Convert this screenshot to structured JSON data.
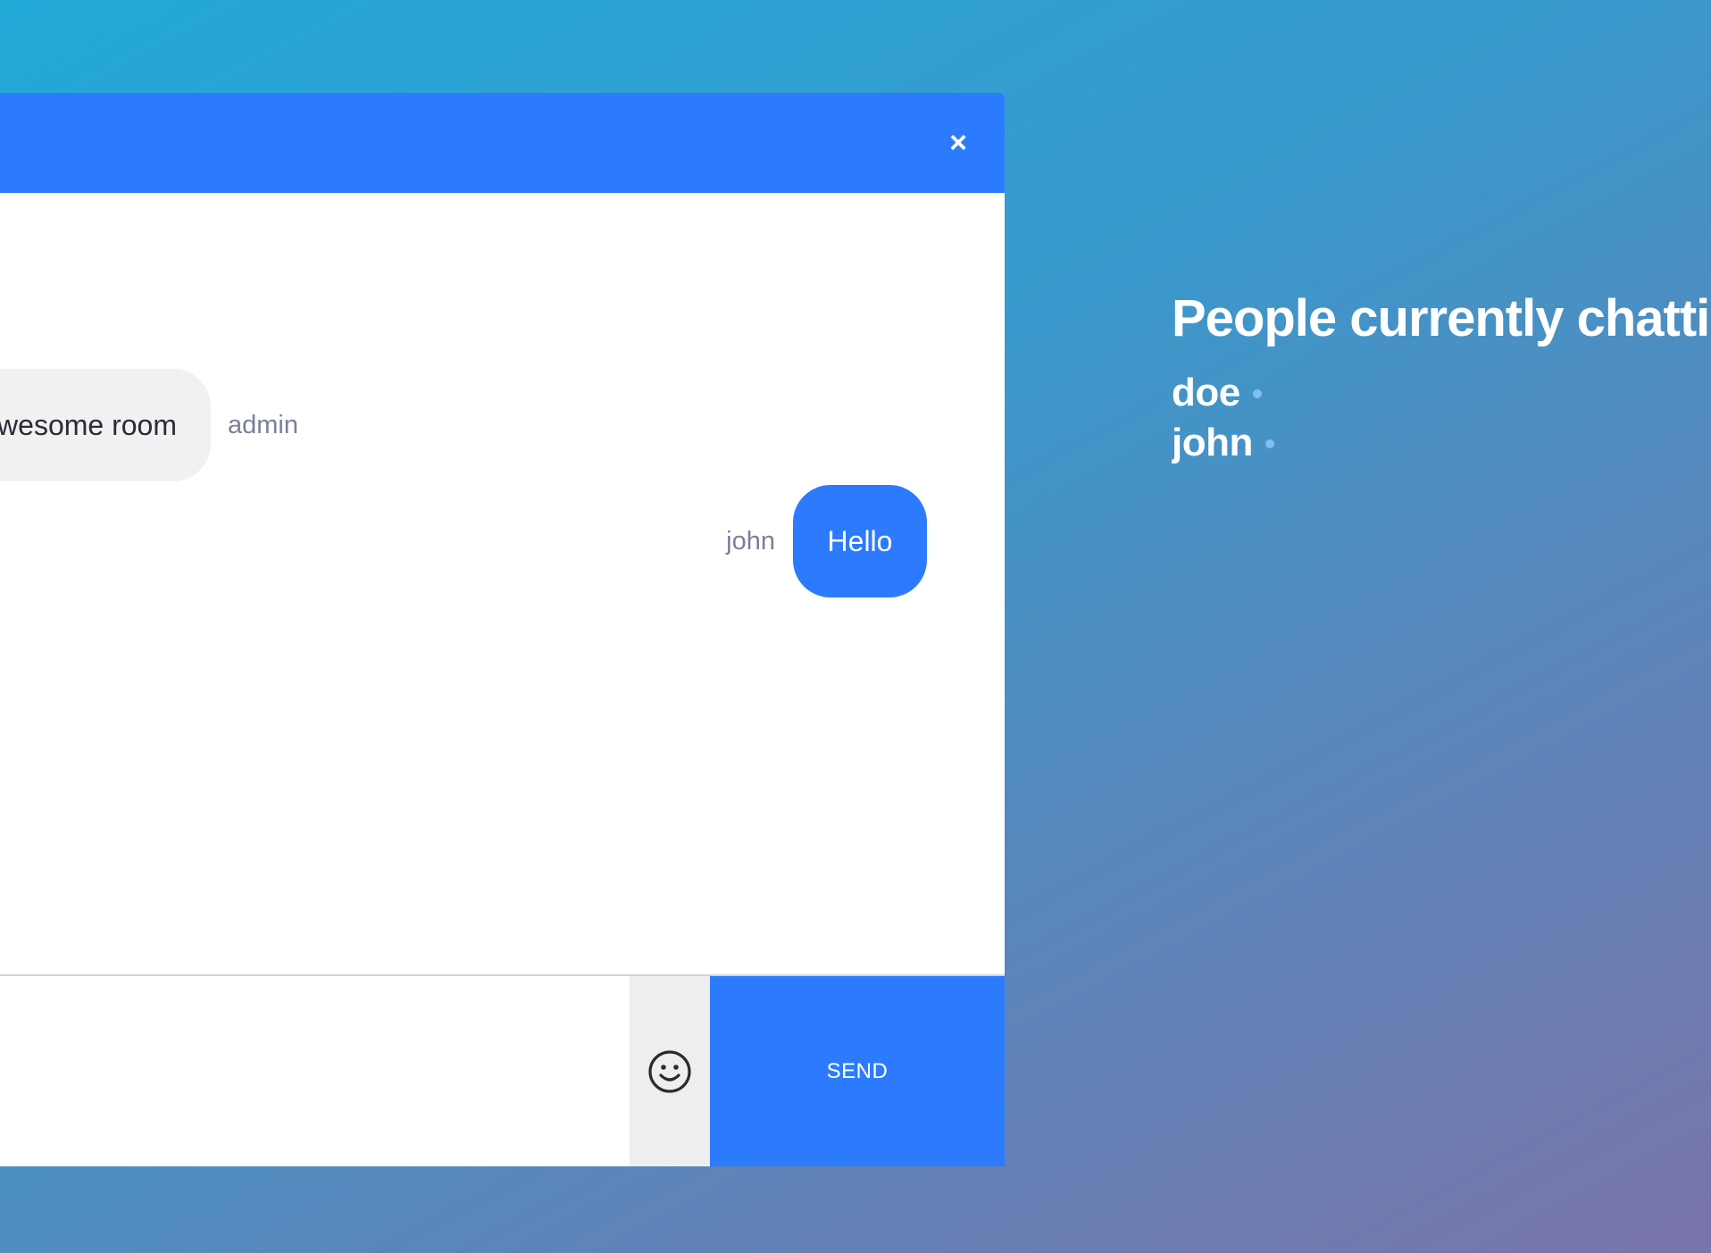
{
  "chat": {
    "close_label": "×",
    "messages": [
      {
        "text": "wesome room",
        "sender": "admin",
        "direction": "incoming"
      },
      {
        "text": "Hello",
        "sender": "john",
        "direction": "outgoing"
      }
    ],
    "composer": {
      "placeholder": "",
      "emoji_icon": "smiley-face-icon",
      "send_label": "SEND"
    }
  },
  "people": {
    "title": "People currently chattin",
    "users": [
      {
        "name": "doe",
        "status": "online"
      },
      {
        "name": "john",
        "status": "online"
      }
    ]
  },
  "colors": {
    "accent": "#2c7bfd",
    "incoming_bubble": "#f1f1f1",
    "sender_text": "#7b7f99",
    "background_start": "#22a9d8",
    "background_end": "#7a74aa"
  }
}
